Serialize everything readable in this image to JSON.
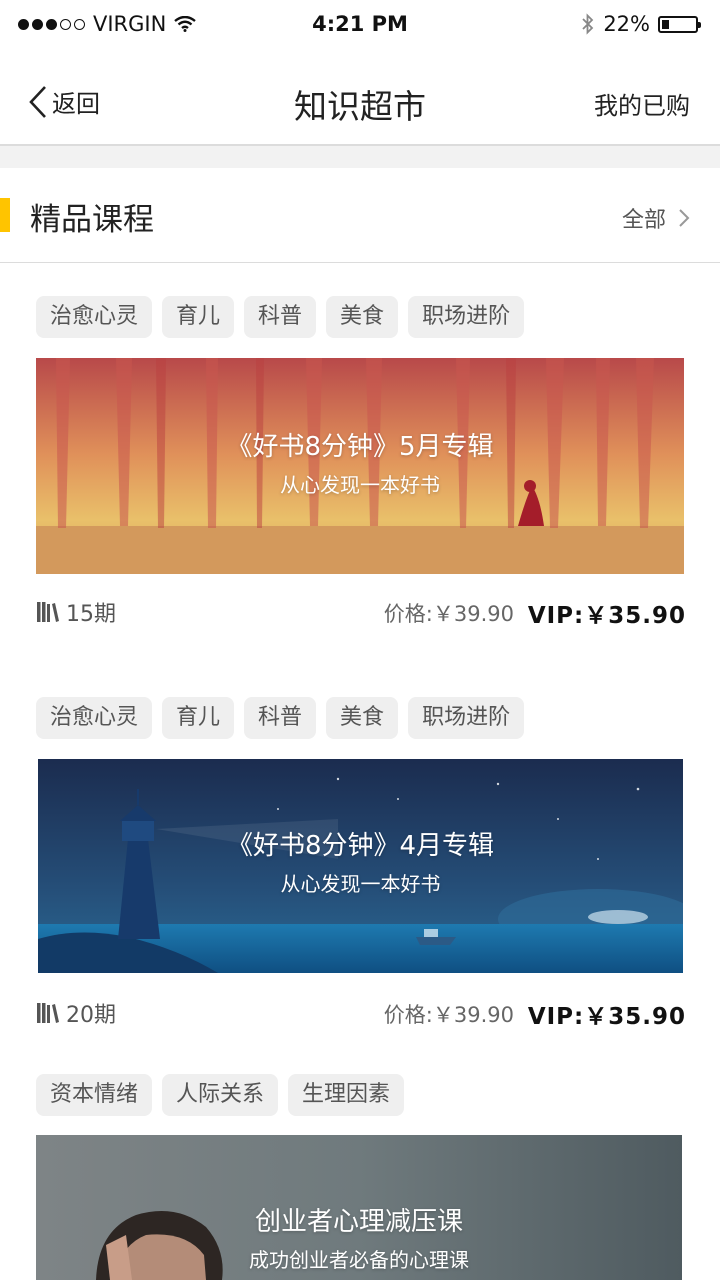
{
  "status_bar": {
    "carrier": "VIRGIN",
    "time": "4:21 PM",
    "battery": "22%",
    "battery_level": 0.22
  },
  "nav": {
    "back_label": "返回",
    "title": "知识超市",
    "purchased_label": "我的已购"
  },
  "section": {
    "title": "精品课程",
    "all_label": "全部"
  },
  "courses": [
    {
      "tags": [
        "治愈心灵",
        "育儿",
        "科普",
        "美食",
        "职场进阶"
      ],
      "banner_title": "《好书8分钟》5月专辑",
      "banner_subtitle": "从心发现一本好书",
      "issues": "15期",
      "price": "价格:￥39.90",
      "vip_price": "VIP:￥35.90"
    },
    {
      "tags": [
        "治愈心灵",
        "育儿",
        "科普",
        "美食",
        "职场进阶"
      ],
      "banner_title": "《好书8分钟》4月专辑",
      "banner_subtitle": "从心发现一本好书",
      "issues": "20期",
      "price": "价格:￥39.90",
      "vip_price": "VIP:￥35.90"
    },
    {
      "tags": [
        "资本情绪",
        "人际关系",
        "生理因素"
      ],
      "banner_title": "创业者心理减压课",
      "banner_subtitle": "成功创业者必备的心理课"
    }
  ],
  "colors": {
    "accent": "#ffc400",
    "tag_bg": "#efefef",
    "divider": "#dcdcdc"
  },
  "icons": [
    "signal-icon",
    "wifi-icon",
    "bluetooth-icon",
    "battery-icon",
    "back-chevron-icon",
    "chevron-right-icon",
    "books-icon"
  ]
}
